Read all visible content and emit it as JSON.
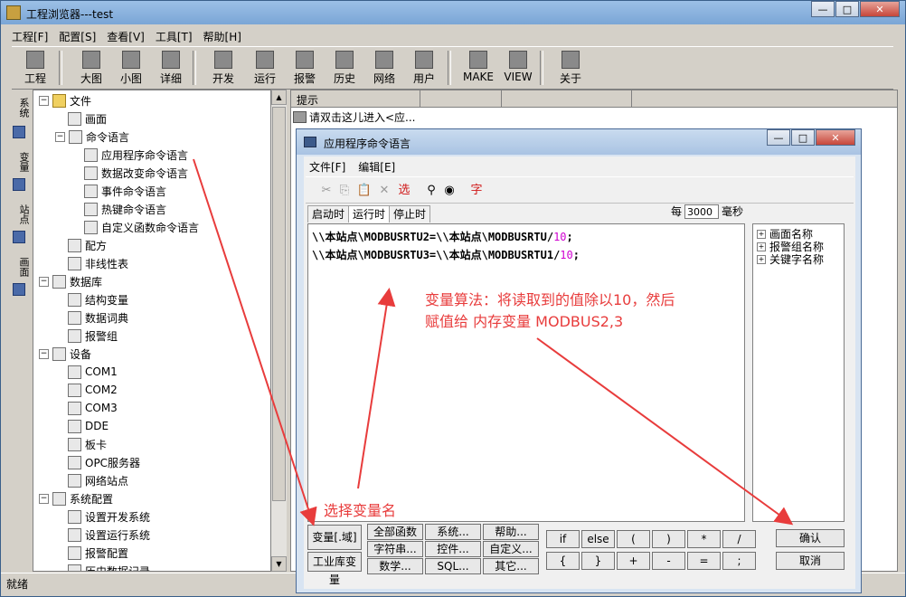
{
  "window": {
    "title": "工程浏览器---test"
  },
  "menubar": [
    "工程[F]",
    "配置[S]",
    "查看[V]",
    "工具[T]",
    "帮助[H]"
  ],
  "toolbar": [
    "工程",
    "大图",
    "小图",
    "详细",
    "开发",
    "运行",
    "报警",
    "历史",
    "网络",
    "用户",
    "MAKE",
    "VIEW",
    "关于"
  ],
  "vtabs": [
    "系统",
    "变量",
    "站点",
    "画面"
  ],
  "tree": [
    {
      "label": "文件",
      "level": 0,
      "expand": "−",
      "icon": "folder-icon"
    },
    {
      "label": "画面",
      "level": 1,
      "icon": "screen-icon"
    },
    {
      "label": "命令语言",
      "level": 1,
      "expand": "−",
      "icon": "command-icon"
    },
    {
      "label": "应用程序命令语言",
      "level": 2,
      "icon": "doc-icon"
    },
    {
      "label": "数据改变命令语言",
      "level": 2,
      "icon": "doc-icon"
    },
    {
      "label": "事件命令语言",
      "level": 2,
      "icon": "doc-icon"
    },
    {
      "label": "热键命令语言",
      "level": 2,
      "icon": "doc-icon"
    },
    {
      "label": "自定义函数命令语言",
      "level": 2,
      "icon": "doc-icon"
    },
    {
      "label": "配方",
      "level": 1,
      "icon": "recipe-icon"
    },
    {
      "label": "非线性表",
      "level": 1,
      "icon": "table-icon"
    },
    {
      "label": "数据库",
      "level": 0,
      "expand": "−",
      "icon": "database-icon"
    },
    {
      "label": "结构变量",
      "level": 1,
      "icon": "struct-icon"
    },
    {
      "label": "数据词典",
      "level": 1,
      "icon": "dictionary-icon"
    },
    {
      "label": "报警组",
      "level": 1,
      "icon": "alarm-group-icon"
    },
    {
      "label": "设备",
      "level": 0,
      "expand": "−",
      "icon": "device-icon"
    },
    {
      "label": "COM1",
      "level": 1,
      "icon": "port-icon"
    },
    {
      "label": "COM2",
      "level": 1,
      "icon": "port-icon"
    },
    {
      "label": "COM3",
      "level": 1,
      "icon": "port-icon"
    },
    {
      "label": "DDE",
      "level": 1,
      "icon": "dde-icon"
    },
    {
      "label": "板卡",
      "level": 1,
      "icon": "board-icon"
    },
    {
      "label": "OPC服务器",
      "level": 1,
      "icon": "opc-icon"
    },
    {
      "label": "网络站点",
      "level": 1,
      "icon": "network-icon"
    },
    {
      "label": "系统配置",
      "level": 0,
      "expand": "−",
      "icon": "tools-icon"
    },
    {
      "label": "设置开发系统",
      "level": 1,
      "icon": "settings-icon"
    },
    {
      "label": "设置运行系统",
      "level": 1,
      "icon": "settings-icon"
    },
    {
      "label": "报警配置",
      "level": 1,
      "icon": "alarm-icon"
    },
    {
      "label": "历史数据记录",
      "level": 1,
      "icon": "history-icon"
    }
  ],
  "rightpane": {
    "header": "提示",
    "hint": "请双击这儿进入<应..."
  },
  "status": "就绪",
  "dialog": {
    "title": "应用程序命令语言",
    "menu": [
      "文件[F]",
      "编辑[E]"
    ],
    "tools": [
      {
        "icon": "cut-icon",
        "glyph": "✂"
      },
      {
        "icon": "copy-icon",
        "glyph": "⎘"
      },
      {
        "icon": "paste-icon",
        "glyph": "📋"
      },
      {
        "icon": "delete-icon",
        "glyph": "✕"
      },
      {
        "icon": "select-icon",
        "glyph": "选"
      },
      {
        "icon": "find-icon",
        "glyph": "⚲"
      },
      {
        "icon": "camera-icon",
        "glyph": "◉"
      },
      {
        "icon": "font-icon",
        "glyph": "字"
      }
    ],
    "tabs": [
      "启动时",
      "运行时",
      "停止时"
    ],
    "every_label": "每",
    "every_value": "3000",
    "every_unit": "毫秒",
    "code": [
      {
        "text": "\\\\本站点\\MODBUSRTU2=\\\\本站点\\MODBUSRTU/",
        "num": "10",
        "end": ";"
      },
      {
        "text": "\\\\本站点\\MODBUSRTU3=\\\\本站点\\MODBUSRTU1/",
        "num": "10",
        "end": ";"
      }
    ],
    "sidetree": [
      "画面名称",
      "报警组名称",
      "关键字名称"
    ],
    "buttons": {
      "var": "变量[.域]",
      "iolib": "工业库变量",
      "allfunc": "全部函数",
      "system": "系统...",
      "help": "帮助...",
      "string": "字符串...",
      "control": "控件...",
      "custom": "自定义...",
      "math": "数学...",
      "sql": "SQL...",
      "other": "其它...",
      "ops1": [
        "if",
        "else",
        "(",
        ")",
        "*",
        "/"
      ],
      "ops2": [
        "{",
        "}",
        "+",
        "-",
        "=",
        ";"
      ],
      "ok": "确认",
      "cancel": "取消"
    }
  },
  "annotations": {
    "formula_line1": "变量算法：将读取到的值除以10，然后",
    "formula_line2": "赋值给 内存变量 MODBUS2,3",
    "select_var": "选择变量名"
  },
  "colors": {
    "annotation": "#e83c3c",
    "number": "#d000d0"
  }
}
